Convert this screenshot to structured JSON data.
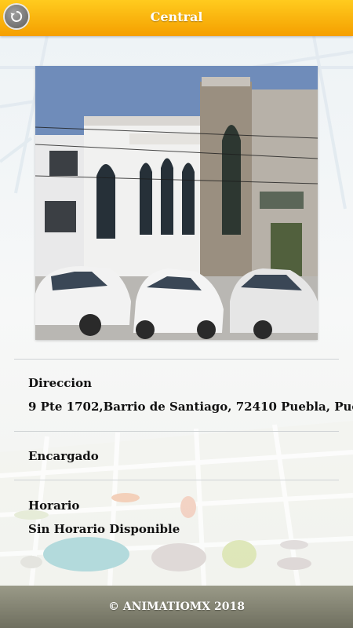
{
  "header": {
    "title": "Central",
    "back_icon": "back-arrow-icon"
  },
  "location": {
    "photo_alt": "building-photo",
    "address_label": "Direccion",
    "address_value": "9 Pte 1702,Barrio de Santiago, 72410 Puebla, Pue",
    "manager_label": "Encargado",
    "manager_value": "",
    "hours_label": "Horario",
    "hours_value": "Sin Horario Disponible"
  },
  "footer": {
    "text": "© ANIMATIOMX 2018"
  },
  "colors": {
    "header_accent": "#f7a900",
    "footer": "#7d7d6d"
  }
}
